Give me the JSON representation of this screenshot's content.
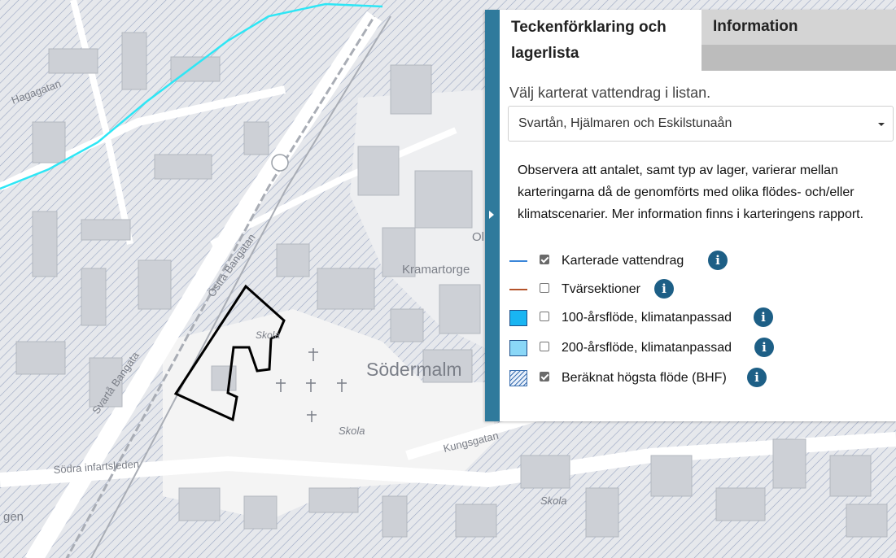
{
  "map": {
    "labels": {
      "hagagatan": "Hagagatan",
      "ostra_bangatan": "Östra Bangatan",
      "svarta_bangata": "Svartå Bangata",
      "sodra_infartsleden": "Södra infartsleden",
      "kramartorget": "Kramartorge",
      "sodermalm": "Södermalm",
      "skola_1": "Skola",
      "skola_2": "Skola",
      "skola_3": "Skola",
      "kungsgatan": "Kungsgatan",
      "gen": "gen",
      "ol": "Ol"
    },
    "colors": {
      "background": "#e6e8ec",
      "building": "#cdd0d6",
      "road": "#ffffff",
      "hatch": "#9aa6c2",
      "river": "#2ee6f5",
      "boundary": "#000000"
    }
  },
  "panel": {
    "tabs": {
      "legend": "Teckenförklaring och lagerlista",
      "info": "Information"
    },
    "select_label": "Välj karterat vattendrag i listan.",
    "select_value": "Svartån, Hjälmaren och Eskilstunaån",
    "note": "Observera att antalet, samt typ av lager, varierar mellan karteringarna då de genomförts med olika flödes- och/eller klimatscenarier. Mer information finns i karteringens rapport.",
    "layers": [
      {
        "label": "Karterade vattendrag",
        "checked": true,
        "symbol": "line",
        "color": "#3a86d9"
      },
      {
        "label": "Tvärsektioner",
        "checked": false,
        "symbol": "line",
        "color": "#b4532a"
      },
      {
        "label": "100-årsflöde, klimatanpassad",
        "checked": false,
        "symbol": "fill",
        "color": "#19b5f2"
      },
      {
        "label": "200-årsflöde, klimatanpassad",
        "checked": false,
        "symbol": "fill",
        "color": "#8ad7f7"
      },
      {
        "label": "Beräknat högsta flöde (BHF)",
        "checked": true,
        "symbol": "hatch",
        "color": "#3a6fb0"
      }
    ],
    "info_icon": "info-icon",
    "accent_color": "#2f7a9c"
  }
}
